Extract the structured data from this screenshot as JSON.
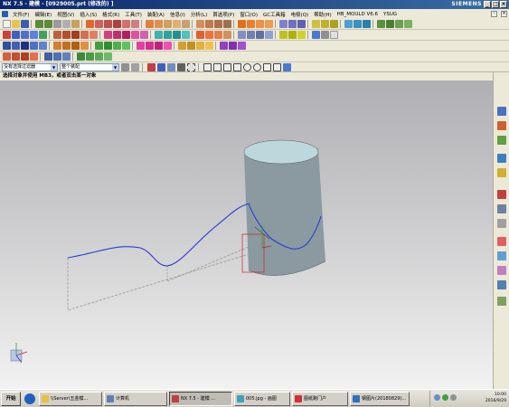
{
  "window": {
    "title": "NX 7.5 - 建模 - [0929005.prt (修改的) ]",
    "brand": "SIEMENS"
  },
  "menu": [
    "文件(F)",
    "编辑(E)",
    "视图(V)",
    "插入(S)",
    "格式(R)",
    "工具(T)",
    "装配(A)",
    "信息(I)",
    "分析(L)",
    "首选项(P)",
    "窗口(O)",
    "GC工具箱",
    "电极(Q)",
    "帮助(H)",
    "HB_MOULD V6.6",
    "YSUG"
  ],
  "selection": {
    "filter": "没有选择过滤器",
    "scope": "整个装配"
  },
  "cue_line": "选择对象并使用 MB3，或者双击某一对象",
  "taskbar": {
    "start": "开始",
    "buttons": [
      "\\\\Server\\五金模...",
      "计算机",
      "NX 7.5 - 建模 ...",
      "005.jpg - 画图",
      "图纸跑门户",
      "钢图片(20180829)..."
    ],
    "clock_time": "10:00",
    "clock_date": "2016/9/29"
  },
  "colors": {
    "curve": "#1f3fd6",
    "cylinder_top": "#bcd8dc",
    "cylinder_side": "#8a9aa0",
    "datum": "#9a9a8a",
    "csys_red": "#cc2222"
  }
}
